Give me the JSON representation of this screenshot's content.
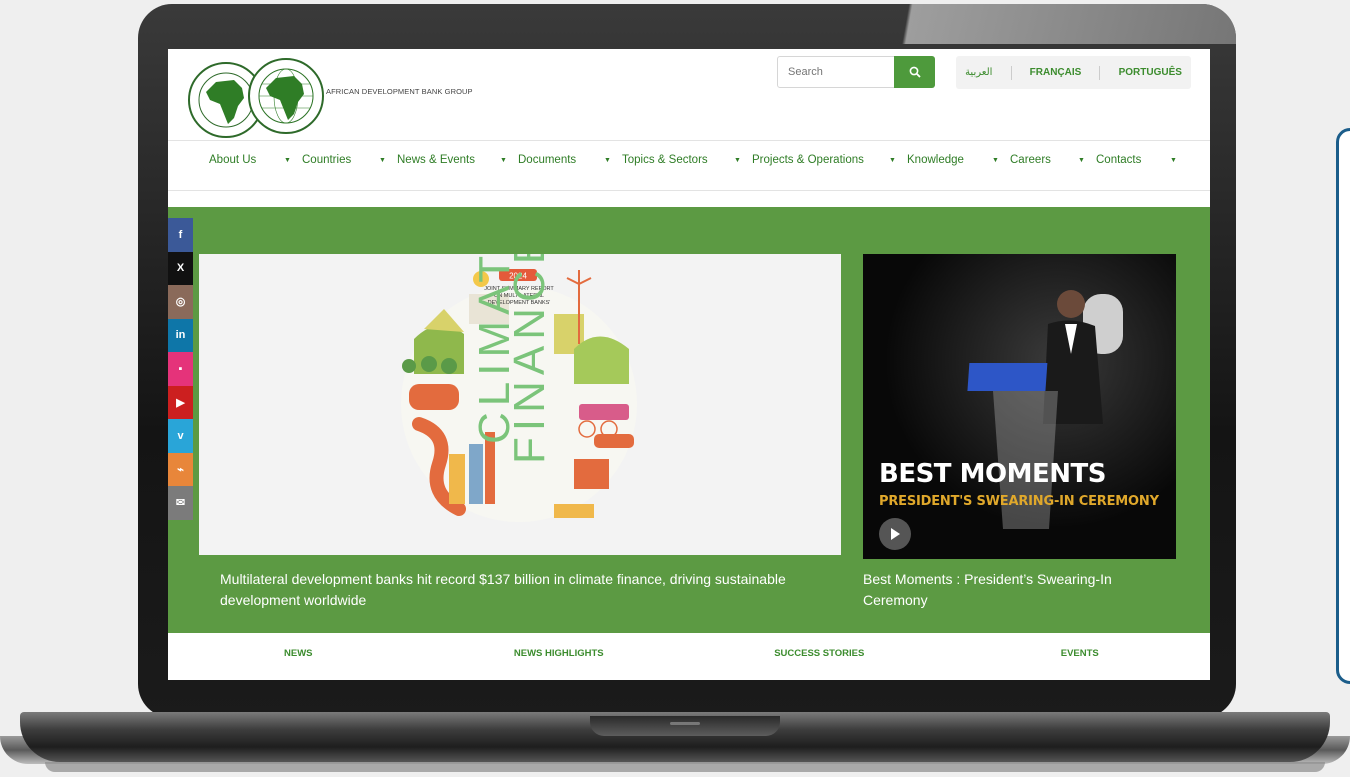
{
  "header": {
    "brand_text": "AFRICAN DEVELOPMENT BANK GROUP",
    "logo_seal_1_text": "BANQUE AFRICAINE DE DEVELOPPEMENT · AFRICAN DEVELOPMENT BANK",
    "logo_seal_2_text": "AFRICAN DEVELOPMENT FUND · FONDS AFRICAIN DE DEVELOPPEMENT",
    "search": {
      "placeholder": "Search"
    },
    "languages": [
      "العربية",
      "FRANÇAIS",
      "PORTUGUÊS"
    ]
  },
  "nav": {
    "items": [
      "About Us",
      "Countries",
      "News & Events",
      "Documents",
      "Topics & Sectors",
      "Projects & Operations",
      "Knowledge",
      "Careers",
      "Contacts"
    ]
  },
  "social": {
    "items": [
      {
        "icon": "facebook-icon",
        "glyph": "f",
        "color": "#3b5998"
      },
      {
        "icon": "x-icon",
        "glyph": "X",
        "color": "#111111"
      },
      {
        "icon": "instagram-icon",
        "glyph": "◎",
        "color": "#8a6a5a"
      },
      {
        "icon": "linkedin-icon",
        "glyph": "in",
        "color": "#0e76a8"
      },
      {
        "icon": "flickr-icon",
        "glyph": "▪",
        "color": "#e5337a"
      },
      {
        "icon": "youtube-icon",
        "glyph": "▶",
        "color": "#cc1f1f"
      },
      {
        "icon": "vimeo-icon",
        "glyph": "v",
        "color": "#29a5d8"
      },
      {
        "icon": "rss-icon",
        "glyph": "⌁",
        "color": "#e8863a"
      },
      {
        "icon": "email-icon",
        "glyph": "✉",
        "color": "#7b7b7b"
      }
    ]
  },
  "hero": {
    "slide1": {
      "year": "2024",
      "report_text": "JOINT SUMMARY REPORT ON MULTILATERAL DEVELOPMENT BANKS'",
      "art_word_1": "CLIMATE",
      "art_word_2": "FINANCE",
      "caption": "Multilateral development banks hit record $137 billion in climate finance, driving sustainable development worldwide"
    },
    "slide2": {
      "title": "BEST MOMENTS",
      "subtitle": "PRESIDENT'S  SWEARING-IN CEREMONY",
      "caption": "Best Moments : President’s Swearing-In Ceremony"
    },
    "dots_count": 3,
    "active_dot": 1
  },
  "tabs": [
    "NEWS",
    "NEWS HIGHLIGHTS",
    "SUCCESS STORIES",
    "EVENTS"
  ],
  "colors": {
    "brand_green": "#5c9a43",
    "link_green": "#2f7d26",
    "accent_orange": "#e0a82b"
  }
}
